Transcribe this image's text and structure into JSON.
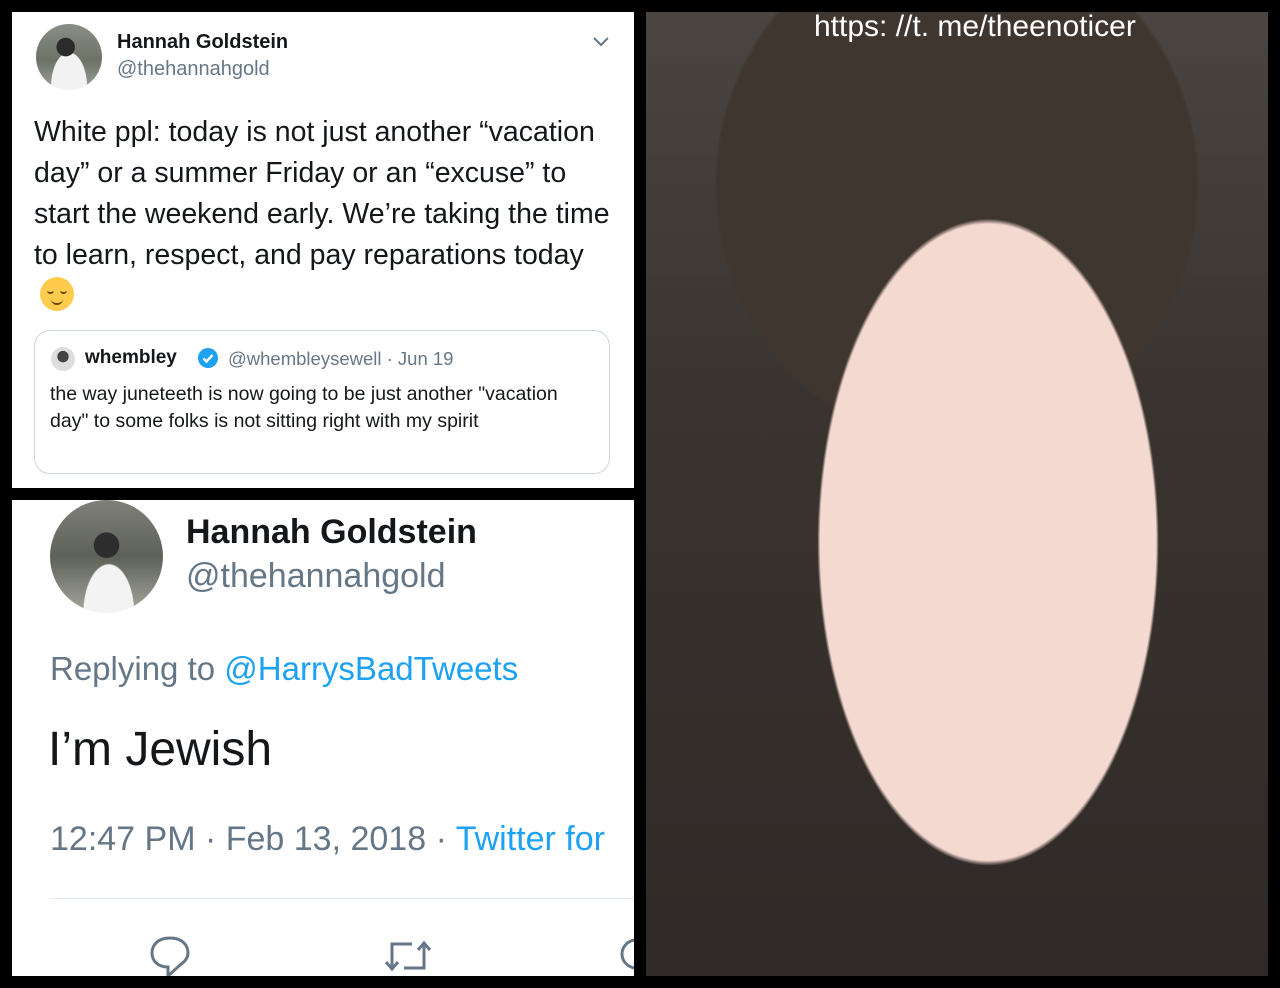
{
  "tweet1": {
    "name": "Hannah Goldstein",
    "handle": "@thehannahgold",
    "text": "White ppl: today is not just another “vacation day” or a summer Friday or an “excuse” to start the weekend early. We’re taking the time to learn, respect, and pay reparations today",
    "emoji": "relieved-face-icon",
    "quote": {
      "name": "whembley",
      "meta": "@whembleysewell · Jun 19",
      "text": "the way juneteeth is now going to be just another \"vacation day\" to some folks is not sitting right with my spirit"
    }
  },
  "tweet2": {
    "name": "Hannah Goldstein",
    "handle": "@thehannahgold",
    "reply_prefix": "Replying to ",
    "reply_to": "@HarrysBadTweets",
    "text": "I’m Jewish",
    "time": "12:47 PM · Feb 13, 2018 · ",
    "source": "Twitter for"
  },
  "photo": {
    "watermark": "https: //t. me/theenoticer"
  },
  "colors": {
    "twitter_blue": "#1da1f2",
    "gray_text": "#657786"
  }
}
